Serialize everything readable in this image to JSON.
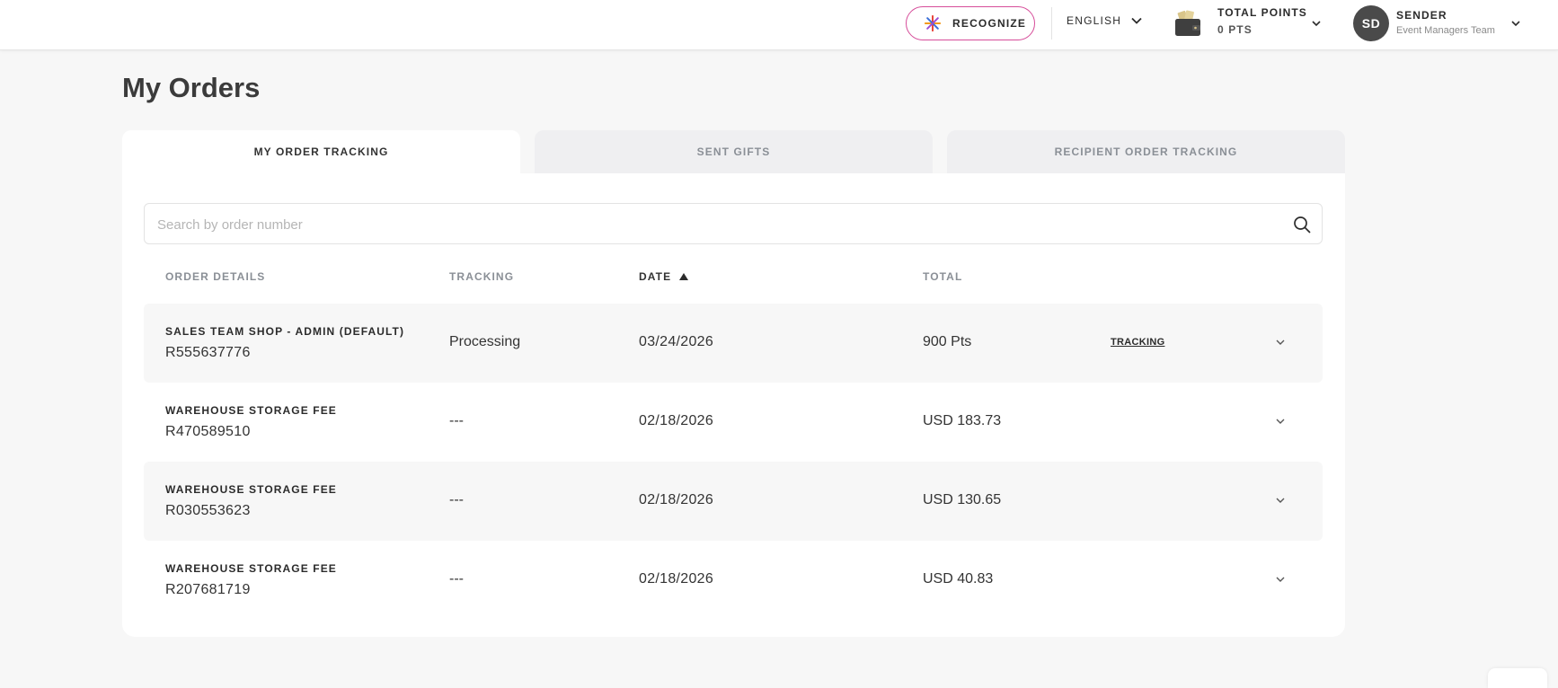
{
  "header": {
    "recognize_label": "RECOGNIZE",
    "language_label": "ENGLISH",
    "points_title": "TOTAL POINTS",
    "points_value": "0 PTS",
    "user_initials": "SD",
    "user_name": "SENDER",
    "user_team": "Event Managers Team",
    "recognize_border_color": "#d64d9a"
  },
  "page": {
    "title": "My Orders"
  },
  "tabs": [
    {
      "label": "MY ORDER TRACKING",
      "active": true
    },
    {
      "label": "SENT GIFTS",
      "active": false
    },
    {
      "label": "RECIPIENT ORDER TRACKING",
      "active": false
    }
  ],
  "search": {
    "placeholder": "Search by order number",
    "value": ""
  },
  "table": {
    "columns": [
      "ORDER DETAILS",
      "TRACKING",
      "DATE",
      "TOTAL"
    ],
    "sorted_column": "DATE",
    "sort_direction": "ascending",
    "rows": [
      {
        "store": "SALES TEAM SHOP - ADMIN (DEFAULT)",
        "order_number": "R555637776",
        "tracking": "Processing",
        "date": "03/24/2026",
        "total": "900 Pts",
        "tracking_link": "TRACKING"
      },
      {
        "store": "WAREHOUSE STORAGE FEE",
        "order_number": "R470589510",
        "tracking": "---",
        "date": "02/18/2026",
        "total": "USD 183.73",
        "tracking_link": ""
      },
      {
        "store": "WAREHOUSE STORAGE FEE",
        "order_number": "R030553623",
        "tracking": "---",
        "date": "02/18/2026",
        "total": "USD 130.65",
        "tracking_link": ""
      },
      {
        "store": "WAREHOUSE STORAGE FEE",
        "order_number": "R207681719",
        "tracking": "---",
        "date": "02/18/2026",
        "total": "USD 40.83",
        "tracking_link": ""
      }
    ]
  },
  "icons": {
    "recognize": "sparkle-icon",
    "language_dropdown": "chevron-down-icon",
    "wallet": "wallet-icon",
    "search": "search-icon",
    "sort": "sort-up-icon",
    "row_expand": "chevron-down-icon"
  }
}
